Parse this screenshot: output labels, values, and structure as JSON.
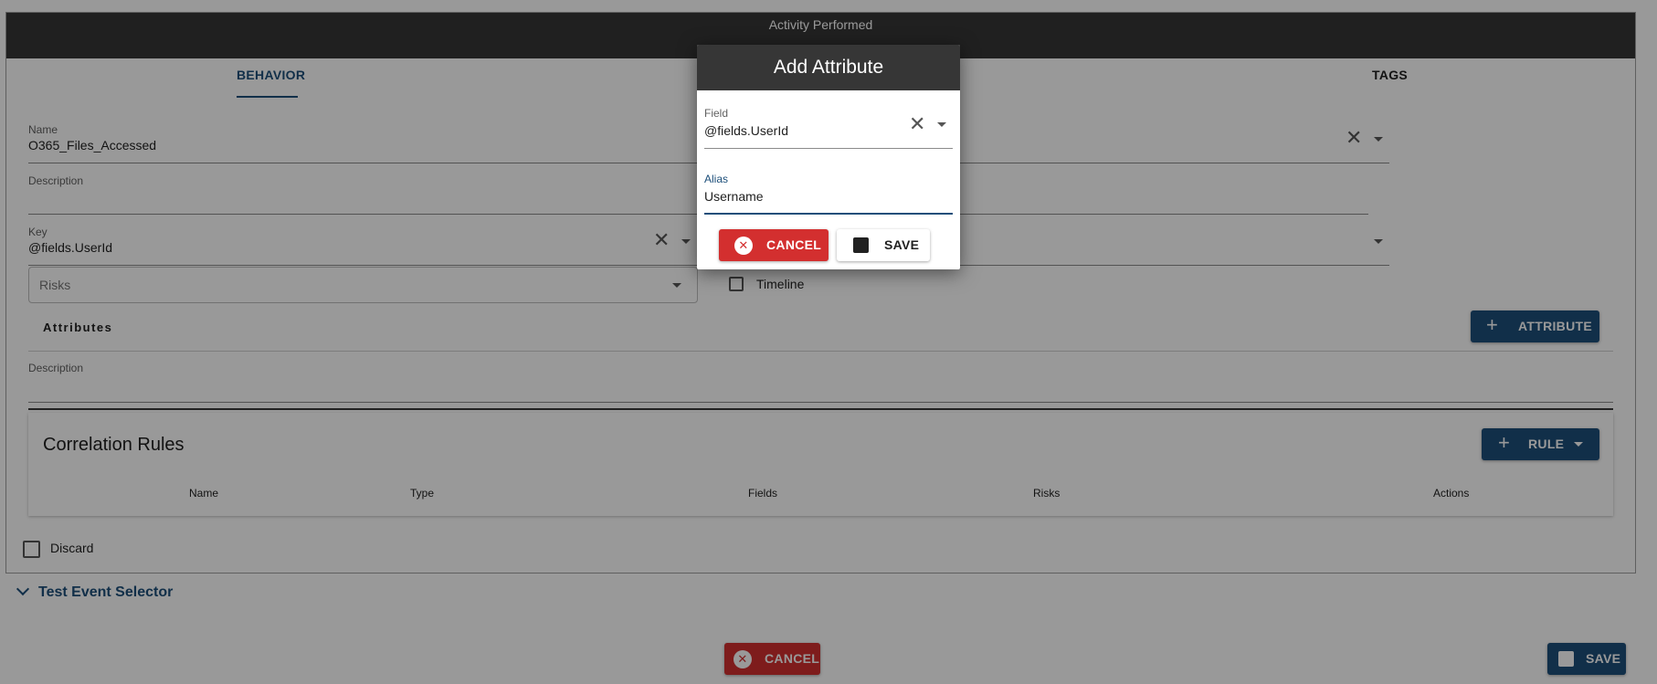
{
  "card": {
    "title": "Activity Performed",
    "tabs": [
      {
        "label": "BEHAVIOR",
        "active": true
      },
      {
        "label": "TAGS",
        "active": false
      }
    ]
  },
  "form": {
    "name_label": "Name",
    "name_value": "O365_Files_Accessed",
    "description_label": "Description",
    "description_value": "",
    "key_label": "Key",
    "key_value": "@fields.UserId",
    "risks_placeholder": "Risks",
    "timeline_label": "Timeline",
    "attributes_label": "Attributes",
    "attribute_button": "ATTRIBUTE",
    "description2_label": "Description"
  },
  "correlation": {
    "title": "Correlation Rules",
    "rule_button": "RULE",
    "columns": [
      "Name",
      "Type",
      "Fields",
      "Risks",
      "Actions"
    ]
  },
  "discard_label": "Discard",
  "test_event_selector": "Test Event Selector",
  "footer": {
    "cancel_label": "CANCEL",
    "save_label": "SAVE"
  },
  "dialog": {
    "title": "Add Attribute",
    "field_label": "Field",
    "field_value": "@fields.UserId",
    "alias_label": "Alias",
    "alias_value": "Username",
    "cancel_label": "CANCEL",
    "save_label": "SAVE"
  },
  "colors": {
    "primary": "#1d4f7a",
    "danger": "#d32f2f",
    "header": "#363636"
  },
  "icons": [
    "close-icon",
    "caret-down-icon",
    "plus-icon",
    "save-icon",
    "cancel-circle-icon",
    "chevron-down-icon"
  ]
}
